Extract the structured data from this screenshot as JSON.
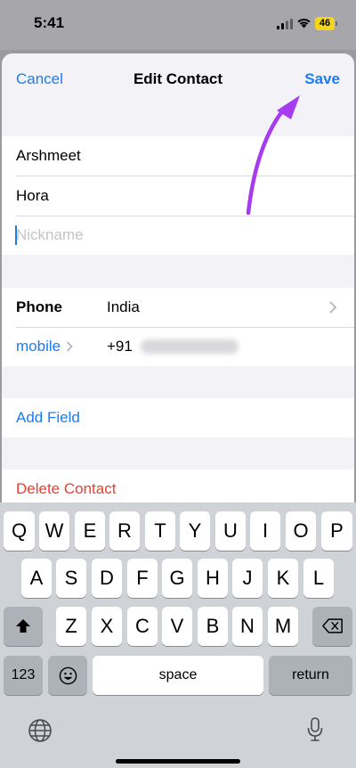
{
  "status": {
    "time": "5:41",
    "battery": "46"
  },
  "nav": {
    "cancel": "Cancel",
    "title": "Edit Contact",
    "save": "Save"
  },
  "name_fields": {
    "first": "Arshmeet",
    "last": "Hora",
    "nickname_placeholder": "Nickname"
  },
  "phone": {
    "label": "Phone",
    "country": "India",
    "type": "mobile",
    "code": "+91"
  },
  "add_field": "Add Field",
  "delete_contact": "Delete Contact",
  "keyboard": {
    "row1": [
      "Q",
      "W",
      "E",
      "R",
      "T",
      "Y",
      "U",
      "I",
      "O",
      "P"
    ],
    "row2": [
      "A",
      "S",
      "D",
      "F",
      "G",
      "H",
      "J",
      "K",
      "L"
    ],
    "row3": [
      "Z",
      "X",
      "C",
      "V",
      "B",
      "N",
      "M"
    ],
    "numbers": "123",
    "space": "space",
    "return": "return"
  },
  "colors": {
    "accent": "#1a7cf5",
    "destructive": "#ef3b2f",
    "annotation": "#a63bef"
  }
}
